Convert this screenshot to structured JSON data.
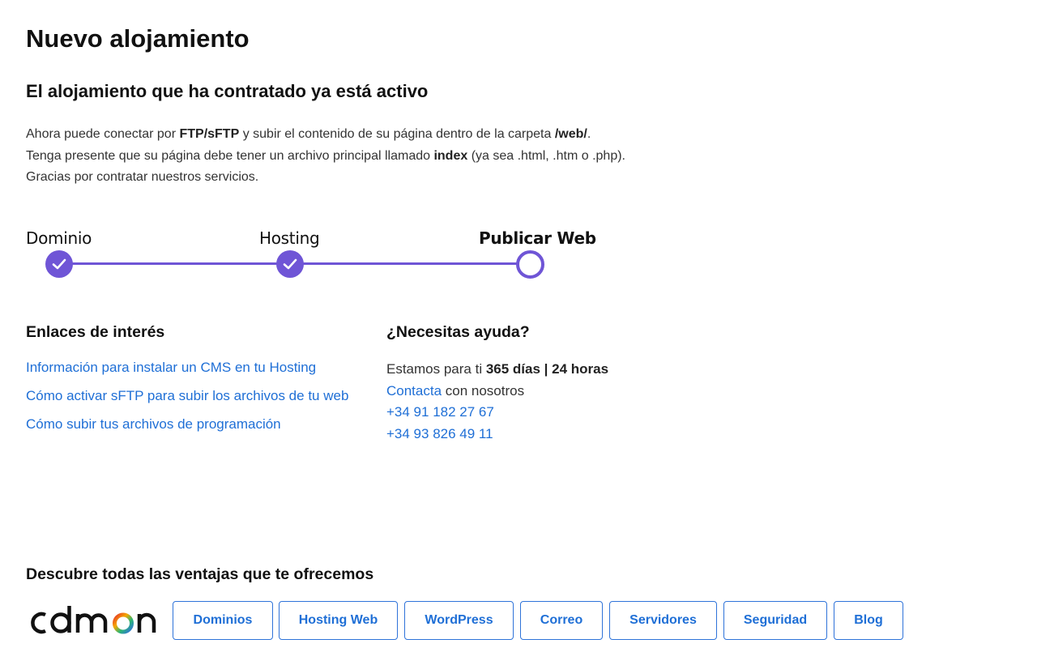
{
  "page": {
    "title": "Nuevo alojamiento",
    "subtitle": "El alojamiento que ha contratado ya está activo"
  },
  "intro": {
    "line1_a": "Ahora puede conectar por ",
    "line1_b": "FTP/sFTP",
    "line1_c": " y subir el contenido de su página dentro de la carpeta ",
    "line1_d": "/web/",
    "line1_e": ".",
    "line2_a": "Tenga presente que su página debe tener un archivo principal llamado ",
    "line2_b": "index",
    "line2_c": " (ya sea .html, .htm o .php).",
    "line3": "Gracias por contratar nuestros servicios."
  },
  "stepper": {
    "steps": [
      {
        "label": "Dominio",
        "status": "done"
      },
      {
        "label": "Hosting",
        "status": "done"
      },
      {
        "label": "Publicar Web",
        "status": "current"
      }
    ],
    "accent_color": "#6f55d6",
    "check_icon": "check-icon"
  },
  "links_section": {
    "heading": "Enlaces de interés",
    "items": [
      "Información para instalar un CMS en tu Hosting",
      "Cómo activar sFTP para subir los archivos de tu web",
      "Cómo subir tus archivos de programación"
    ]
  },
  "help_section": {
    "heading": "¿Necesitas ayuda?",
    "availability_prefix": "Estamos para ti ",
    "availability_bold": "365 días | 24 horas",
    "contact_link": "Contacta",
    "contact_suffix": " con nosotros",
    "phone_1": "+34 91 182 27 67",
    "phone_2": "+34 93 826 49 11"
  },
  "footer": {
    "heading": "Descubre todas las ventajas que te ofrecemos",
    "logo": "cdmon",
    "buttons": [
      "Dominios",
      "Hosting Web",
      "WordPress",
      "Correo",
      "Servidores",
      "Seguridad",
      "Blog"
    ]
  },
  "colors": {
    "link": "#1f6fd6",
    "button_border": "#2f73d9",
    "logo_dark": "#111111"
  }
}
